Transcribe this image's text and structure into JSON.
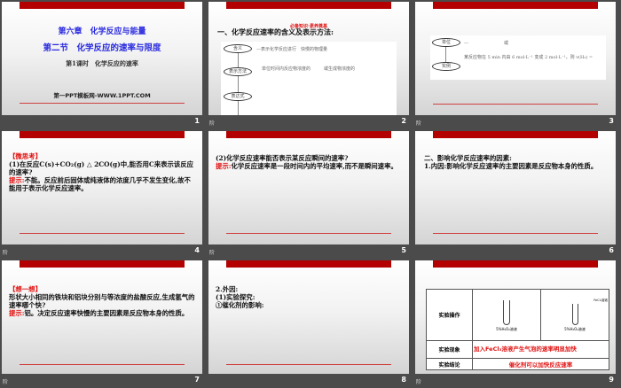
{
  "slides": [
    {
      "number": "1",
      "chapter": "第六章　化学反应与能量",
      "section": "第二节　化学反应的速率与限度",
      "lesson": "第1课时　化学反应的速率",
      "site": "第一PPT模板网-WWW.1PPT.COM"
    },
    {
      "number": "2",
      "banner": "必备知识·素养奠基",
      "heading": "一、化学反应速率的含义及表示方法:",
      "nodes": [
        "含义",
        "表示方法",
        "表达式"
      ],
      "line1": "—表示化学反应进行　快慢的物理量",
      "line2": "单位时间内反应物浓度的　　　或生成物浓度的",
      "tag": "阶"
    },
    {
      "number": "3",
      "nodes": [
        "单位",
        "实例"
      ],
      "line1": "—　　　　　　　　或",
      "line2": "某反应物在 5 min 内由 6 mol·L⁻¹ 变成 2 mol·L⁻¹，则 v(H₂) =",
      "tag": "阶"
    },
    {
      "number": "4",
      "title": "【微思考】",
      "question": "(1)在反应C(s)+CO₂(g) △ 2CO(g)中,能否用C来表示该反应的速率?",
      "hint_label": "提示:",
      "hint": "不能。反应前后固体或纯液体的浓度几乎不发生变化,故不能用于表示化学反应速率。",
      "tag": "阶"
    },
    {
      "number": "5",
      "question": "(2)化学反应速率能否表示某反应瞬间的速率?",
      "hint_label": "提示:",
      "hint": "化学反应速率是一段时间内的平均速率,而不是瞬间速率。",
      "tag": "阶"
    },
    {
      "number": "6",
      "heading": "二、影响化学反应速率的因素:",
      "text": "1.内因:影响化学反应速率的主要因素是反应物本身的性质。"
    },
    {
      "number": "7",
      "title": "【想一想】",
      "question": "形状大小相同的铁块和铝块分别与等浓度的盐酸反应,生成氢气的速率哪个快?",
      "hint_label": "提示:",
      "hint": "铝。决定反应速率快慢的主要因素是反应物本身的性质。",
      "tag": "阶"
    },
    {
      "number": "8",
      "line1": "2.外因:",
      "line2": "(1)实验探究:",
      "line3": "①催化剂的影响:"
    },
    {
      "number": "9",
      "row1": "实验操作",
      "row2": "实验现象",
      "row3": "实验结论",
      "img1": "5%H₂O₂溶液",
      "img2": "5%H₂O₂溶液",
      "img2_label": "FeCl₃溶液",
      "obs": "加入FeCl₃溶液产生气泡的速率明显加快",
      "conc": "催化剂可以加快反应速率",
      "tag": "阶"
    }
  ]
}
